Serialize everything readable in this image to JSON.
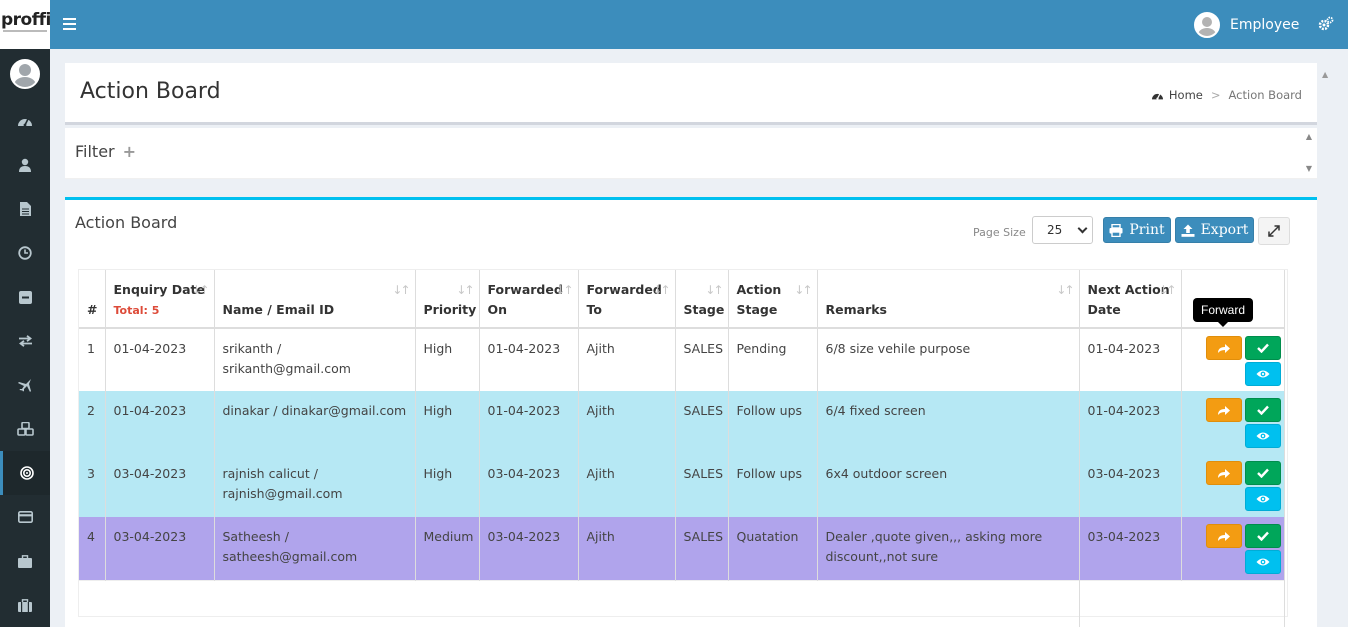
{
  "app": {
    "logo_text": "proffin",
    "user_name": "Employee"
  },
  "header": {
    "title": "Action Board",
    "breadcrumb": {
      "home": "Home",
      "separator": ">",
      "current": "Action Board"
    }
  },
  "filter": {
    "title": "Filter",
    "plus": "+"
  },
  "board": {
    "title": "Action Board",
    "page_size_label": "Page Size",
    "page_size_value": "25",
    "print_label": "Print",
    "export_label": "Export",
    "tooltip": "Forward"
  },
  "sidebar": {
    "items": [
      {
        "icon": "dashboard-icon"
      },
      {
        "icon": "user-icon"
      },
      {
        "icon": "file-icon"
      },
      {
        "icon": "clock-icon"
      },
      {
        "icon": "minus-square-icon"
      },
      {
        "icon": "exchange-icon"
      },
      {
        "icon": "plane-icon"
      },
      {
        "icon": "cubes-icon"
      },
      {
        "icon": "bullseye-icon",
        "active": true
      },
      {
        "icon": "credit-card-icon"
      },
      {
        "icon": "briefcase-icon"
      },
      {
        "icon": "suitcase-icon"
      }
    ]
  },
  "table": {
    "columns": {
      "num": "#",
      "enquiry_date": "Enquiry Date",
      "total": "Total: 5",
      "name_email": "Name / Email ID",
      "priority": "Priority",
      "forwarded_on": "Forwarded On",
      "forwarded_to": "Forwarded To",
      "stage": "Stage",
      "action_stage": "Action Stage",
      "remarks": "Remarks",
      "next_action_date": "Next Action Date"
    },
    "rows": [
      {
        "num": "1",
        "enquiry_date": "01-04-2023",
        "name_email": "srikanth / srikanth@gmail.com",
        "priority": "High",
        "forwarded_on": "01-04-2023",
        "forwarded_to": "Ajith",
        "stage": "SALES",
        "action_stage": "Pending",
        "remarks": "6/8 size vehile purpose",
        "next_action_date": "01-04-2023"
      },
      {
        "num": "2",
        "enquiry_date": "01-04-2023",
        "name_email": "dinakar / dinakar@gmail.com",
        "priority": "High",
        "forwarded_on": "01-04-2023",
        "forwarded_to": "Ajith",
        "stage": "SALES",
        "action_stage": "Follow ups",
        "remarks": "6/4 fixed screen",
        "next_action_date": "01-04-2023"
      },
      {
        "num": "3",
        "enquiry_date": "03-04-2023",
        "name_email": "rajnish calicut / rajnish@gmail.com",
        "priority": "High",
        "forwarded_on": "03-04-2023",
        "forwarded_to": "Ajith",
        "stage": "SALES",
        "action_stage": "Follow ups",
        "remarks": "6x4 outdoor screen",
        "next_action_date": "03-04-2023"
      },
      {
        "num": "4",
        "enquiry_date": "03-04-2023",
        "name_email": "Satheesh / satheesh@gmail.com",
        "priority": "Medium",
        "forwarded_on": "03-04-2023",
        "forwarded_to": "Ajith",
        "stage": "SALES",
        "action_stage": "Quatation",
        "remarks": "Dealer ,quote given,,, asking more discount,,not sure",
        "next_action_date": "03-04-2023"
      }
    ]
  },
  "colors": {
    "header_blue": "#3c8dbc",
    "sidebar_dark": "#222d32",
    "row_cyan": "#b6e8f4",
    "row_purple": "#b0a4ec",
    "forward_orange": "#f39c12",
    "ok_green": "#00a65a",
    "view_cyan": "#00c0ef"
  }
}
